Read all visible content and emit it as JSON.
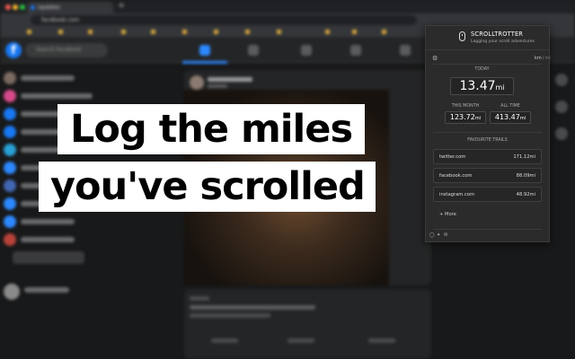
{
  "headline": {
    "line1": "Log the miles",
    "line2": "you've scrolled"
  },
  "popup": {
    "title": "SCROLLTROTTER",
    "tagline": "Logging your scroll adventures",
    "units": {
      "active": "km",
      "separator": "/",
      "inactive": "mi"
    },
    "today": {
      "label": "TODAY",
      "value": "13.47",
      "unit": "mi"
    },
    "this_month": {
      "label": "THIS MONTH",
      "value": "123.72",
      "unit": "mi"
    },
    "all_time": {
      "label": "ALL TIME",
      "value": "413.47",
      "unit": "mi"
    },
    "trails_label": "FAVOURITE TRAILS",
    "trails": [
      {
        "site": "twitter.com",
        "distance": "171.12mi"
      },
      {
        "site": "facebook.com",
        "distance": "88.09mi"
      },
      {
        "site": "instagram.com",
        "distance": "48.92mi"
      }
    ],
    "more_label": "+ More",
    "icons": [
      "mouse-icon",
      "gear-icon",
      "instagram-icon",
      "twitter-icon",
      "mail-icon"
    ]
  },
  "browser": {
    "tab_title": "Updates",
    "url": "facebook.com",
    "search_placeholder": "Search Facebook",
    "accent": "#2d88ff"
  }
}
